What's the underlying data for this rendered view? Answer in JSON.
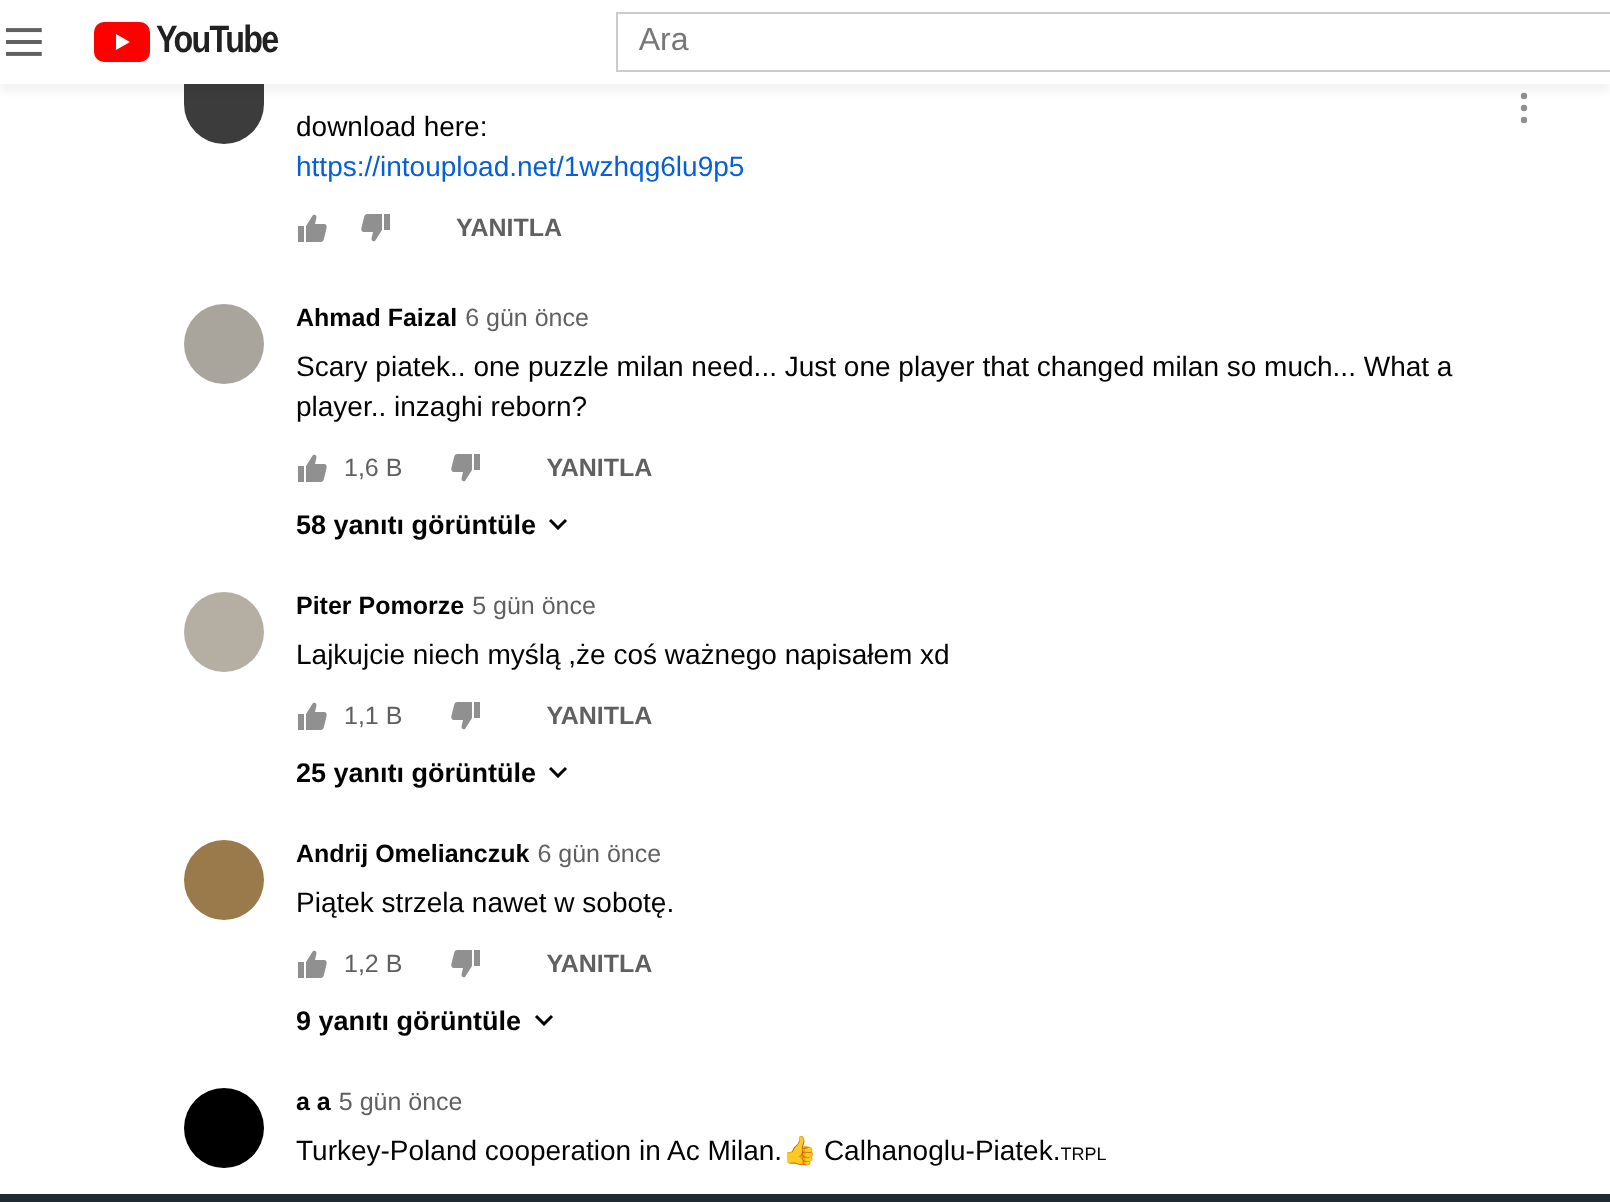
{
  "header": {
    "logo": "YouTube",
    "search": {
      "placeholder": "Ara"
    }
  },
  "comments": [
    {
      "color": "#3c3c3c",
      "body": "download here:",
      "link": "https://intoupload.net/1wzhqg6lu9p5",
      "reply": "YANITLA",
      "menu": true
    },
    {
      "color": "#a9a59c",
      "author": "Ahmad Faizal",
      "time": "6 gün önce",
      "body": "Scary piatek.. one puzzle milan need... Just one player that changed milan so much... What a player.. inzaghi reborn?",
      "likes": "1,6 B",
      "reply": "YANITLA",
      "replies": "58 yanıtı görüntüle"
    },
    {
      "color": "#b5aea2",
      "author": "Piter Pomorze",
      "time": "5 gün önce",
      "body": "Lajkujcie niech myślą ,że coś ważnego napisałem xd",
      "likes": "1,1 B",
      "reply": "YANITLA",
      "replies": "25 yanıtı görüntüle"
    },
    {
      "color": "#9a7a4a",
      "author": "Andrij Omelianczuk",
      "time": "6 gün önce",
      "body": "Piątek strzela nawet w sobotę.",
      "likes": "1,2 B",
      "reply": "YANITLA",
      "replies": "9 yanıtı görüntüle"
    },
    {
      "color": "#000000",
      "author": "a a",
      "time": "5 gün önce",
      "body": "Turkey-Poland cooperation in Ac Milan.👍 Calhanoglu-Piatek.$_{TRPL}$"
    }
  ]
}
